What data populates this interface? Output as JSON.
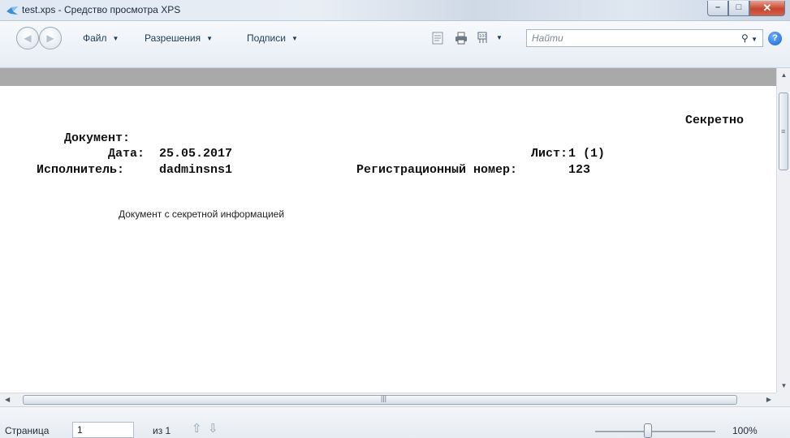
{
  "window": {
    "title": "test.xps - Средство просмотра XPS"
  },
  "toolbar": {
    "menus": [
      {
        "label": "Файл"
      },
      {
        "label": "Разрешения"
      },
      {
        "label": "Подписи"
      }
    ],
    "search_placeholder": "Найти",
    "icons": [
      "outline-icon",
      "print-icon",
      "zoom-fit-icon",
      "search-icon",
      "help-icon"
    ]
  },
  "document": {
    "classification": "Секретно",
    "fields": {
      "document_label": "Документ:",
      "date_label": "Дата:",
      "date_value": "25.05.2017",
      "sheet_label": "Лист:",
      "sheet_value": "1 (1)",
      "executor_label": "Исполнитель:",
      "executor_value": "dadminsns1",
      "regnum_label": "Регистрационный номер:",
      "regnum_value": "123"
    },
    "body": "Документ с секретной информацией"
  },
  "statusbar": {
    "page_label": "Страница",
    "page_value": "1",
    "of_label": "из 1",
    "zoom": "100%"
  },
  "colors": {
    "gray_band": "#a9a9a9",
    "accent_link": "#1e3b5a"
  }
}
